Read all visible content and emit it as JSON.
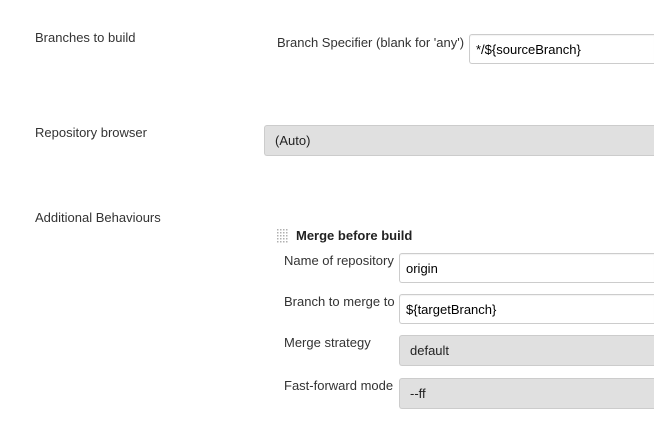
{
  "branches": {
    "section_label": "Branches to build",
    "specifier_label": "Branch Specifier (blank for 'any')",
    "specifier_value": "*/${sourceBranch}"
  },
  "repository_browser": {
    "section_label": "Repository browser",
    "selected": "(Auto)"
  },
  "additional_behaviours": {
    "section_label": "Additional Behaviours",
    "merge": {
      "title": "Merge before build",
      "handle_icon": "drag-handle-icon",
      "repo_name_label": "Name of repository",
      "repo_name_value": "origin",
      "merge_to_label": "Branch to merge to",
      "merge_to_value": "${targetBranch}",
      "strategy_label": "Merge strategy",
      "strategy_selected": "default",
      "ff_label": "Fast-forward mode",
      "ff_selected": "--ff"
    }
  }
}
